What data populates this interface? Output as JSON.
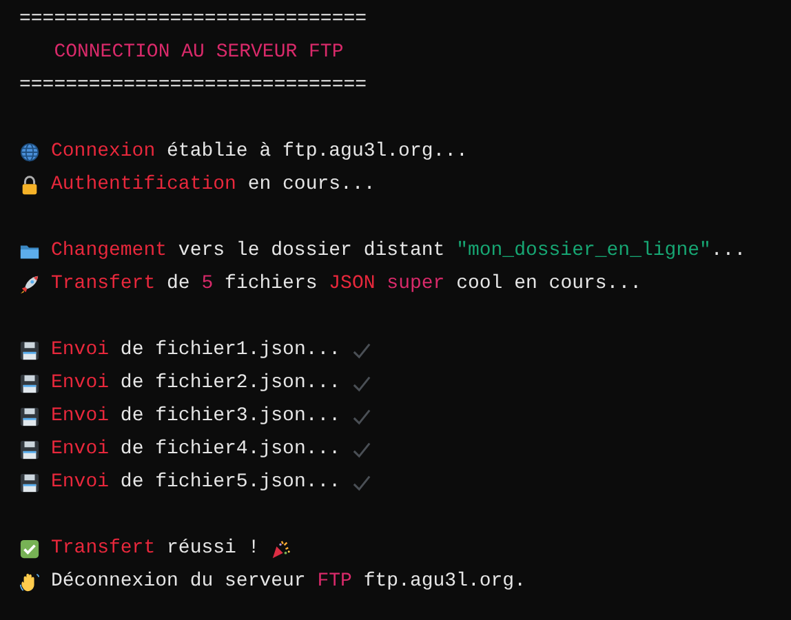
{
  "blocks": [
    [
      {
        "kind": "rule",
        "segments": [
          {
            "text": "=============================="
          }
        ]
      },
      {
        "kind": "heading",
        "segments": [
          {
            "text": "CONNECTION AU SERVEUR FTP",
            "color": "#d92a6a"
          }
        ]
      },
      {
        "kind": "rule",
        "segments": [
          {
            "text": "=============================="
          }
        ]
      }
    ],
    [
      {
        "kind": "globe",
        "segments": [
          {
            "text": "Connexion",
            "color": "#e8283c"
          },
          {
            "text": " établie à ftp.agu3l.org..."
          }
        ]
      },
      {
        "kind": "lock",
        "segments": [
          {
            "text": "Authentification",
            "color": "#e8283c"
          },
          {
            "text": " en cours..."
          }
        ]
      }
    ],
    [
      {
        "kind": "folder",
        "segments": [
          {
            "text": "Changement",
            "color": "#e8283c"
          },
          {
            "text": " vers le dossier distant "
          },
          {
            "text": "\"mon_dossier_en_ligne\"",
            "color": "#17a673"
          },
          {
            "text": "..."
          }
        ]
      },
      {
        "kind": "rocket",
        "segments": [
          {
            "text": "Transfert",
            "color": "#e8283c"
          },
          {
            "text": " de "
          },
          {
            "text": "5",
            "color": "#d92a6a"
          },
          {
            "text": " fichiers "
          },
          {
            "text": "JSON",
            "color": "#e8283c"
          },
          {
            "text": " super",
            "color": "#d92a6a"
          },
          {
            "text": " cool en cours..."
          }
        ]
      }
    ],
    [
      {
        "kind": "disk",
        "trail": {
          "kind": "tick"
        },
        "segments": [
          {
            "text": "Envoi",
            "color": "#e8283c"
          },
          {
            "text": " de fichier1.json..."
          }
        ]
      },
      {
        "kind": "disk",
        "trail": {
          "kind": "tick"
        },
        "segments": [
          {
            "text": "Envoi",
            "color": "#e8283c"
          },
          {
            "text": " de fichier2.json..."
          }
        ]
      },
      {
        "kind": "disk",
        "trail": {
          "kind": "tick"
        },
        "segments": [
          {
            "text": "Envoi",
            "color": "#e8283c"
          },
          {
            "text": " de fichier3.json..."
          }
        ]
      },
      {
        "kind": "disk",
        "trail": {
          "kind": "tick"
        },
        "segments": [
          {
            "text": "Envoi",
            "color": "#e8283c"
          },
          {
            "text": " de fichier4.json..."
          }
        ]
      },
      {
        "kind": "disk",
        "trail": {
          "kind": "tick"
        },
        "segments": [
          {
            "text": "Envoi",
            "color": "#e8283c"
          },
          {
            "text": " de fichier5.json..."
          }
        ]
      }
    ],
    [
      {
        "kind": "check",
        "trail": {
          "kind": "party"
        },
        "segments": [
          {
            "text": "Transfert",
            "color": "#e8283c"
          },
          {
            "text": " réussi !"
          }
        ]
      },
      {
        "kind": "wave",
        "segments": [
          {
            "text": "Déconnexion du serveur "
          },
          {
            "text": "FTP",
            "color": "#d92a6a"
          },
          {
            "text": " ftp.agu3l.org."
          }
        ]
      }
    ]
  ]
}
